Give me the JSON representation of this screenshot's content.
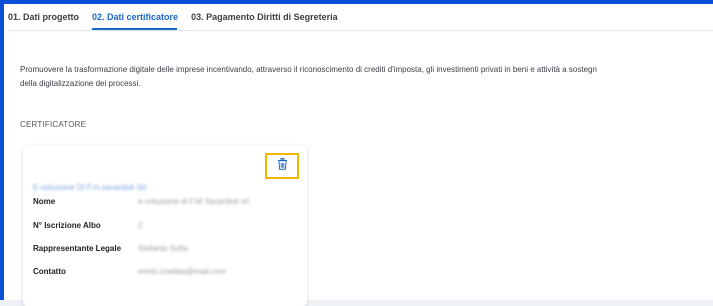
{
  "tabs": [
    {
      "label": "01. Dati progetto",
      "active": false
    },
    {
      "label": "02. Dati certificatore",
      "active": true
    },
    {
      "label": "03. Pagamento Diritti di Segreteria",
      "active": false
    }
  ],
  "description": {
    "line1": "Promuovere la trasformazione digitale delle imprese incentivando, attraverso il riconoscimento di crediti d'imposta, gli investimenti privati in beni e attività a sostegn",
    "line2": "della digitalizzazione dei processi."
  },
  "section": {
    "title": "CERTIFICATORE"
  },
  "certificatore_card": {
    "heading": "E-voluzione Di F.m.sacerdoti Srl",
    "delete_icon": "trash-icon",
    "rows": [
      {
        "label": "Nome",
        "value": "e-voluzione di F.M Sacerdoti srl"
      },
      {
        "label": "N° Iscrizione Albo",
        "value": "2"
      },
      {
        "label": "Rappresentante Legale",
        "value": "Stefania Sofia"
      },
      {
        "label": "Contatto",
        "value": "ennio.cnebba@mail.com"
      }
    ]
  },
  "colors": {
    "accent_blue": "#1a67c8",
    "frame_blue": "#0a4fd6",
    "highlight_yellow": "#f4b400"
  }
}
